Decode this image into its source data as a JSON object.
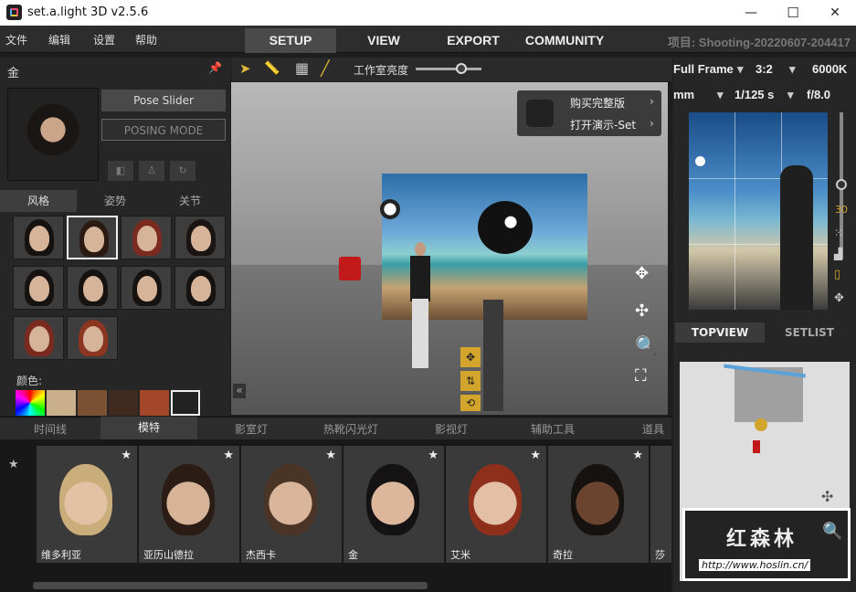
{
  "window": {
    "title": "set.a.light 3D v2.5.6",
    "min": "—",
    "max": "☐",
    "close": "✕"
  },
  "menubar": {
    "menus": [
      "文件",
      "编辑",
      "设置",
      "帮助"
    ],
    "tabs": [
      "SETUP",
      "VIEW",
      "EXPORT",
      "COMMUNITY"
    ],
    "active_tab": "SETUP",
    "project": "项目: Shooting-20220607-204417"
  },
  "left_panel": {
    "model_name": "金",
    "pose_slider": "Pose Slider",
    "posing_mode": "POSING MODE",
    "subtabs": [
      "风格",
      "姿势",
      "关节"
    ],
    "color_label": "颜色:"
  },
  "viewport": {
    "toolbar_label": "工作室亮度",
    "brightness": 0.7,
    "menu": [
      "购买完整版",
      "打开演示-Set"
    ]
  },
  "camera": {
    "format": "Full Frame",
    "ratio": "3:2",
    "kelvin": "6000K",
    "focal": "mm",
    "shutter": "1/125 s",
    "aperture": "f/8.0",
    "iso": "30"
  },
  "right_tabs": [
    "TOPVIEW",
    "SETLIST"
  ],
  "bottom_tabs": [
    "时间线",
    "模特",
    "影室灯",
    "热靴闪光灯",
    "影视灯",
    "辅助工具",
    "道具"
  ],
  "models": [
    "维多利亚",
    "亚历山德拉",
    "杰西卡",
    "金",
    "艾米",
    "奇拉",
    "莎拉"
  ],
  "watermark": {
    "brand": "红森林",
    "url": "http://www.hoslin.cn/"
  },
  "colors": {
    "accent": "#d4a52c",
    "panel": "#262626"
  }
}
